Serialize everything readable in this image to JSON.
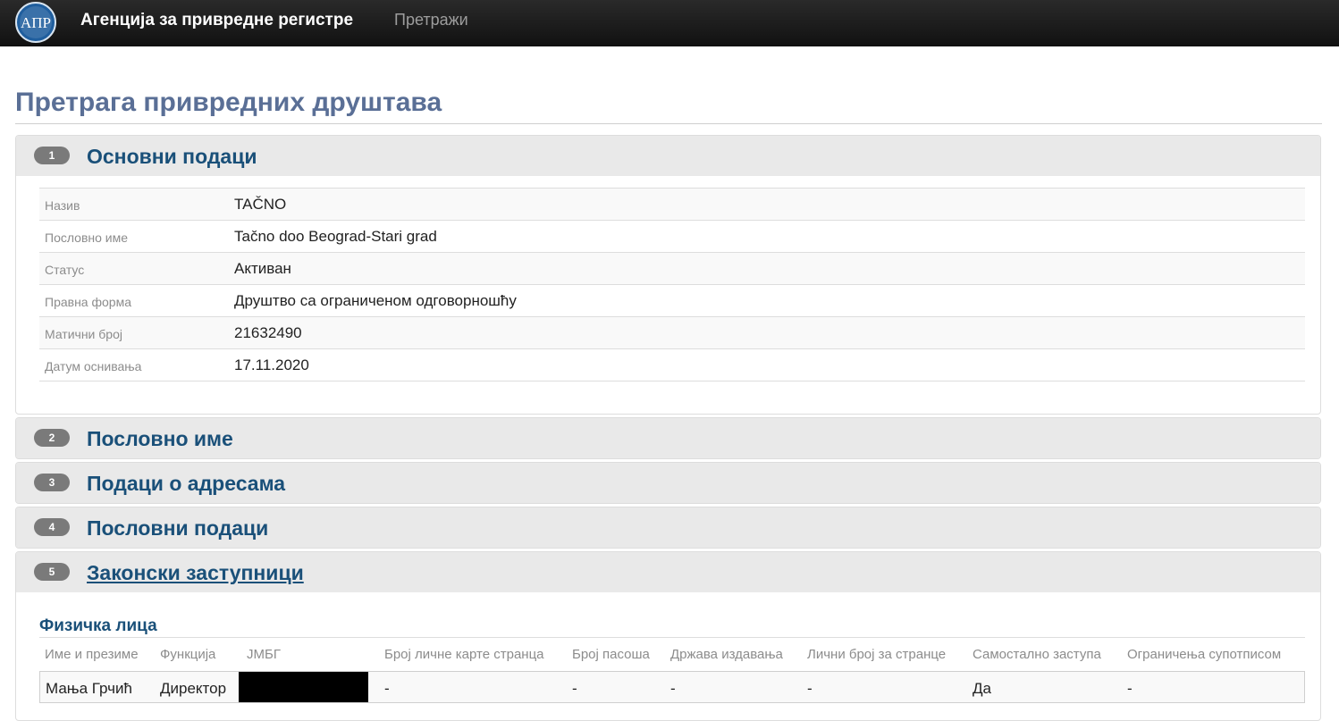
{
  "navbar": {
    "logo_text": "АПР",
    "brand": "Агенција за привредне регистре",
    "search_link": "Претражи"
  },
  "page_title": "Претрага привредних друштава",
  "sections": [
    {
      "num": "1",
      "title": "Основни подаци"
    },
    {
      "num": "2",
      "title": "Пословно име"
    },
    {
      "num": "3",
      "title": "Подаци о адресама"
    },
    {
      "num": "4",
      "title": "Пословни подаци"
    },
    {
      "num": "5",
      "title": "Законски заступници"
    }
  ],
  "basic_info": [
    {
      "label": "Назив",
      "value": "TAČNO"
    },
    {
      "label": "Пословно име",
      "value": "Tačno doo Beograd-Stari grad"
    },
    {
      "label": "Статус",
      "value": "Активан"
    },
    {
      "label": "Правна форма",
      "value": "Друштво са ограниченом одговорношћу"
    },
    {
      "label": "Матични број",
      "value": "21632490"
    },
    {
      "label": "Датум оснивања",
      "value": "17.11.2020"
    }
  ],
  "representatives": {
    "subtitle": "Физичка лица",
    "columns": [
      "Име и презиме",
      "Функција",
      "ЈМБГ",
      "Број личне карте странца",
      "Број пасоша",
      "Држава издавања",
      "Лични број за странце",
      "Самостално заступа",
      "Ограничења супотписом"
    ],
    "rows": [
      [
        "Мања Грчић",
        "Директор",
        "",
        "-",
        "-",
        "-",
        "-",
        "Да",
        "-"
      ]
    ]
  },
  "colors": {
    "navbar": "#1c1c1c",
    "page_title": "#5a6f96",
    "section_title": "#1a5079",
    "panel_header": "#e9e9e9",
    "badge": "#7a7a7a"
  }
}
